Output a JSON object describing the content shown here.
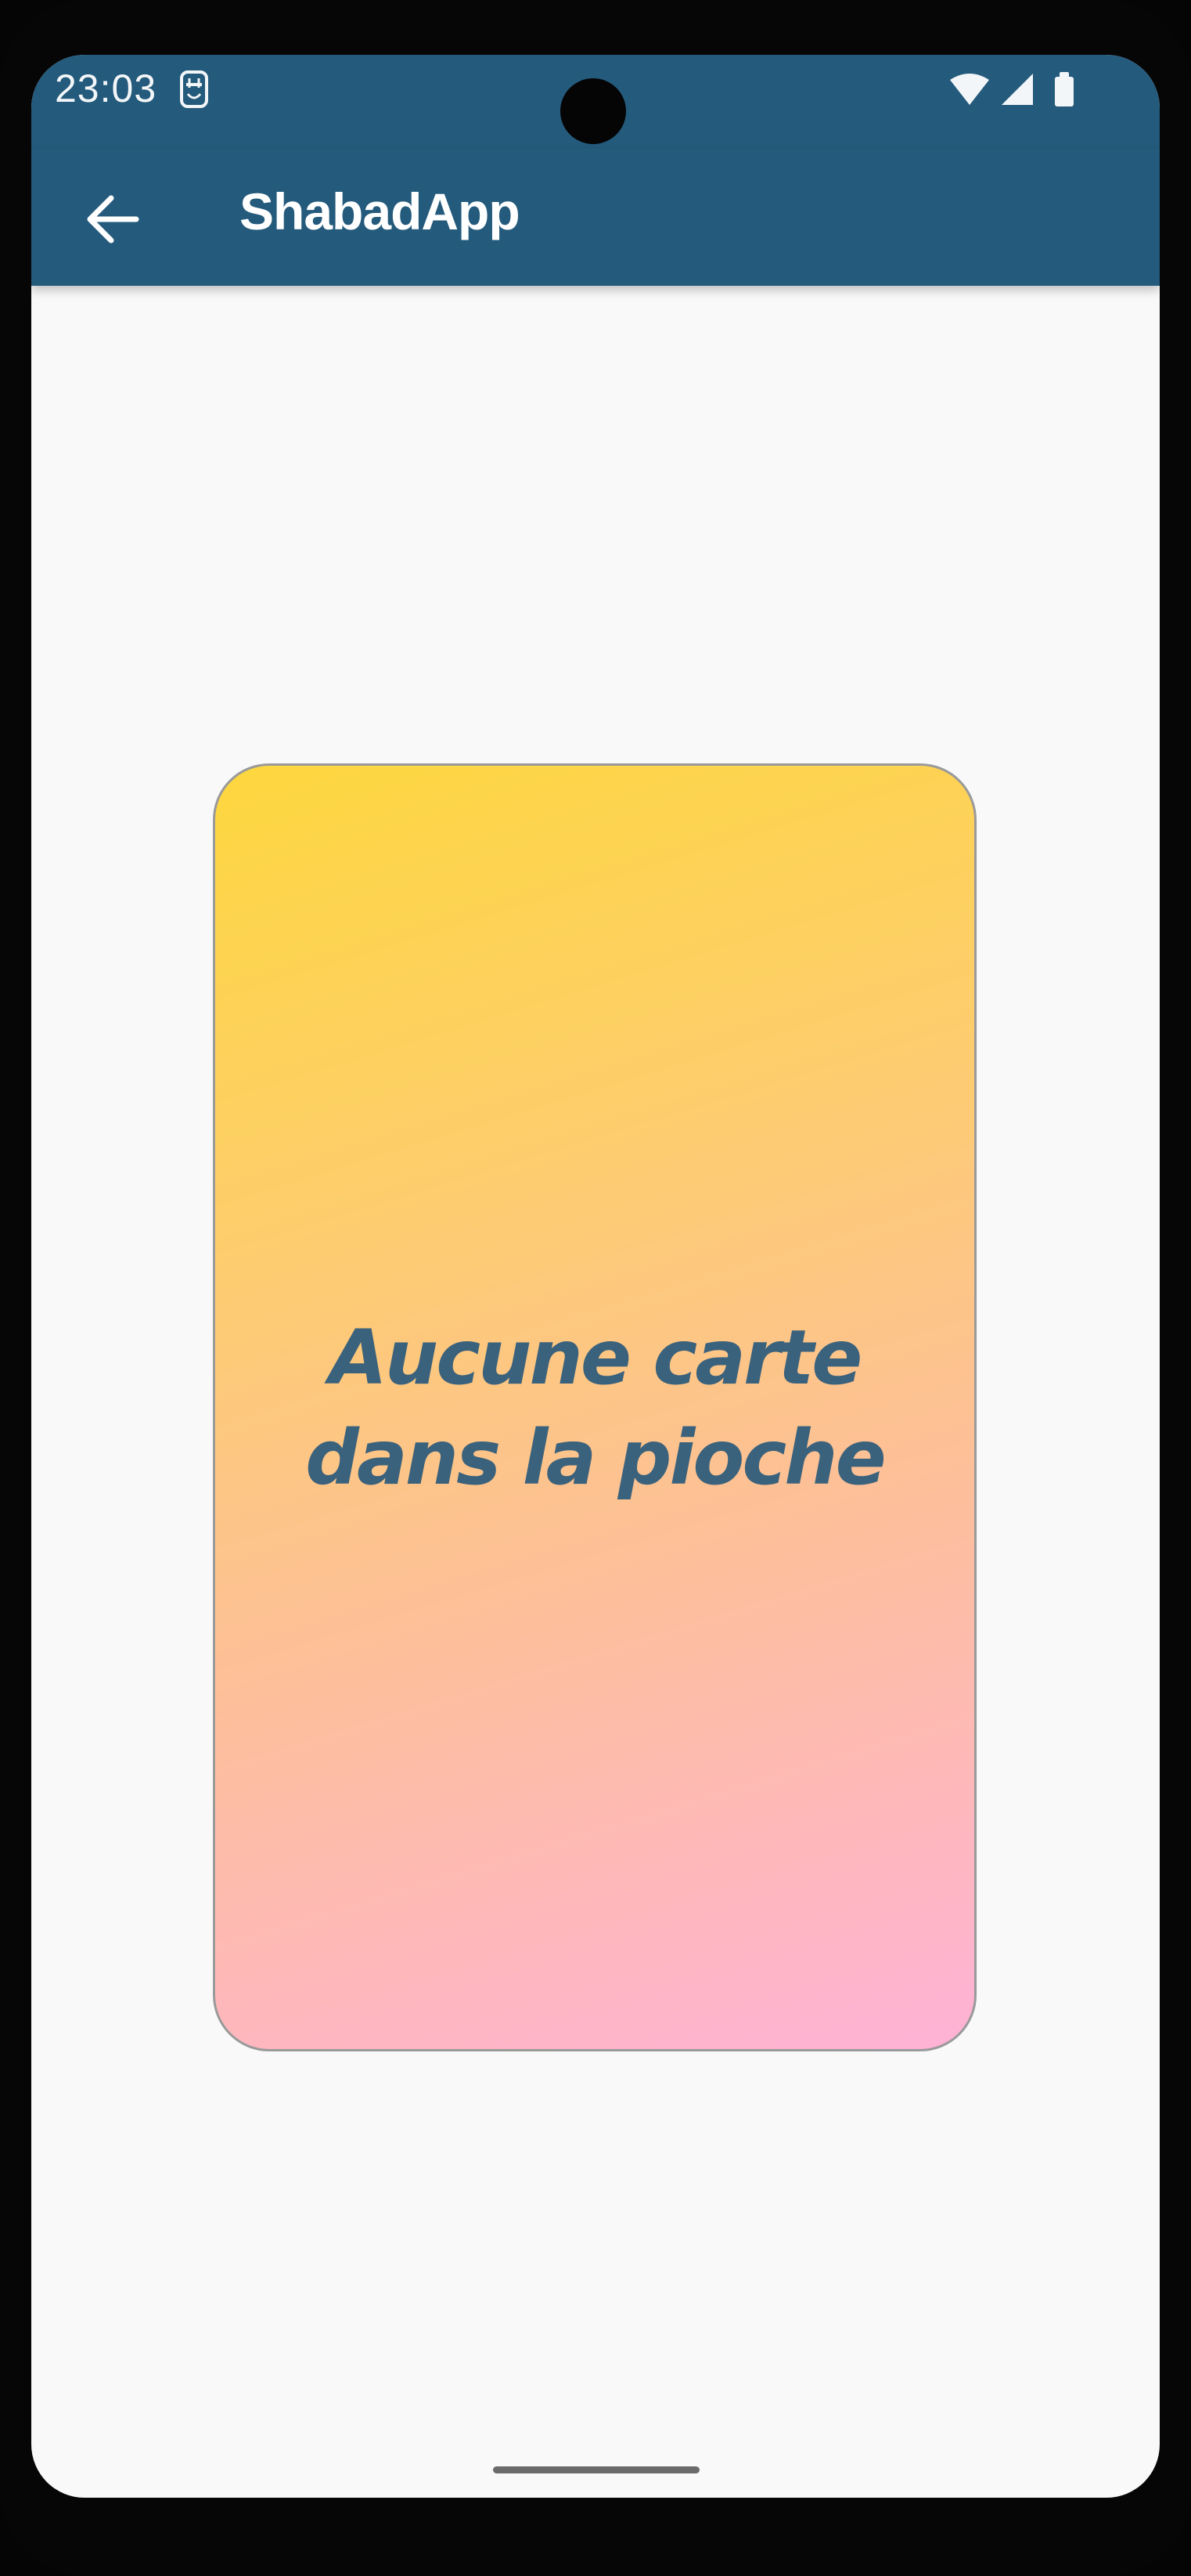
{
  "status_bar": {
    "time": "23:03",
    "notification_icon": "sim-card-alert-icon",
    "icons": [
      "wifi-icon",
      "cell-signal-icon",
      "battery-icon"
    ]
  },
  "app_bar": {
    "back_icon": "arrow-back-icon",
    "title": "ShabadApp"
  },
  "card": {
    "message": "Aucune carte dans la pioche",
    "colors": {
      "gradient_top": "#fdd73e",
      "gradient_bottom": "#feb2d6",
      "text": "#3b627c"
    }
  },
  "colors": {
    "primary": "#245a7c",
    "background": "#f9f9f9"
  }
}
